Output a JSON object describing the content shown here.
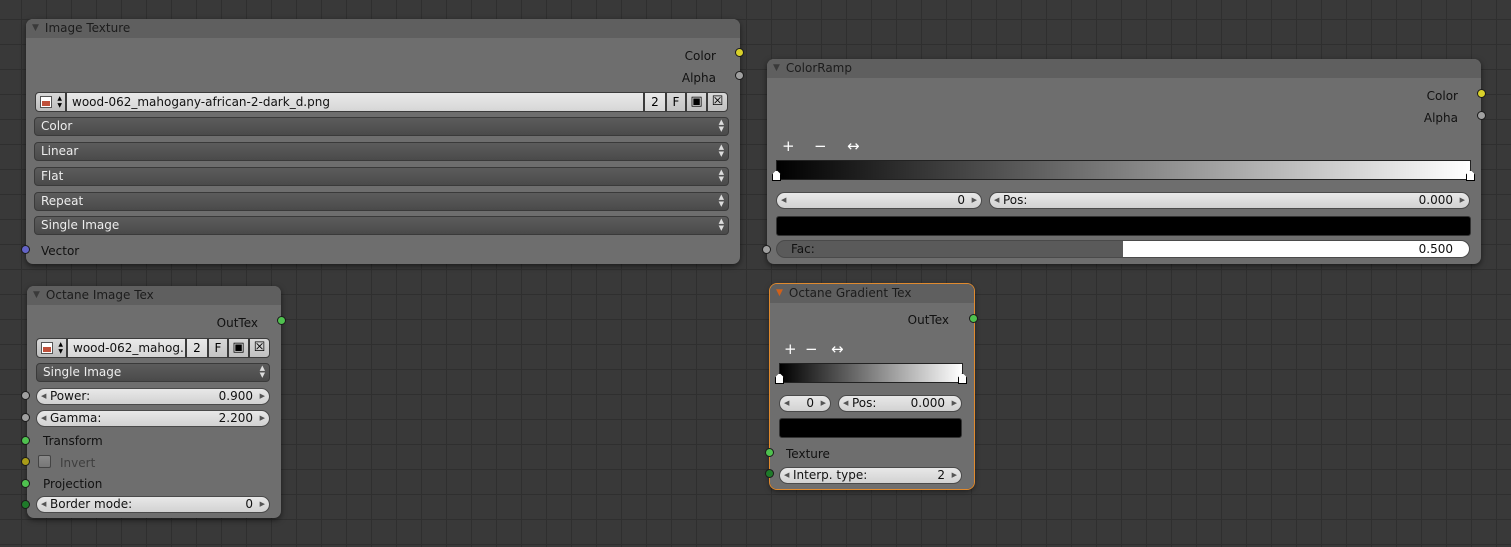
{
  "colors": {
    "socket_color": "#d9d12a",
    "socket_float": "#a0a0a0",
    "socket_vector": "#6363c7",
    "socket_octane": "#4fc14f",
    "socket_octane_dark": "#1f7a2a",
    "socket_yellow_dark": "#a89b18",
    "active_outline": "#e08a2e"
  },
  "image_texture": {
    "title": "Image Texture",
    "outputs": [
      "Color",
      "Alpha"
    ],
    "image": {
      "name": "wood-062_mahogany-african-2-dark_d.png",
      "users": "2",
      "fake": "F"
    },
    "dropdowns": [
      "Color",
      "Linear",
      "Flat",
      "Repeat",
      "Single Image"
    ],
    "input_vector": "Vector"
  },
  "color_ramp": {
    "title": "ColorRamp",
    "outputs": [
      "Color",
      "Alpha"
    ],
    "tools": {
      "add": "+",
      "remove": "−",
      "flip": "↔"
    },
    "stop_index": "0",
    "pos_label": "Pos:",
    "pos_value": "0.000",
    "fac_label": "Fac:",
    "fac_value": "0.500",
    "fac_fraction": 0.5
  },
  "octane_image_tex": {
    "title": "Octane Image Tex",
    "output": "OutTex",
    "image": {
      "name": "wood-062_mahog...",
      "users": "2",
      "fake": "F"
    },
    "mode": "Single Image",
    "power_label": "Power:",
    "power_value": "0.900",
    "gamma_label": "Gamma:",
    "gamma_value": "2.200",
    "transform_label": "Transform",
    "invert_label": "Invert",
    "projection_label": "Projection",
    "border_label": "Border mode:",
    "border_value": "0"
  },
  "octane_gradient_tex": {
    "title": "Octane Gradient Tex",
    "output": "OutTex",
    "tools": {
      "add": "+",
      "remove": "−",
      "flip": "↔"
    },
    "stop_index": "0",
    "pos_label": "Pos:",
    "pos_value": "0.000",
    "texture_label": "Texture",
    "interp_label": "Interp. type:",
    "interp_value": "2"
  }
}
